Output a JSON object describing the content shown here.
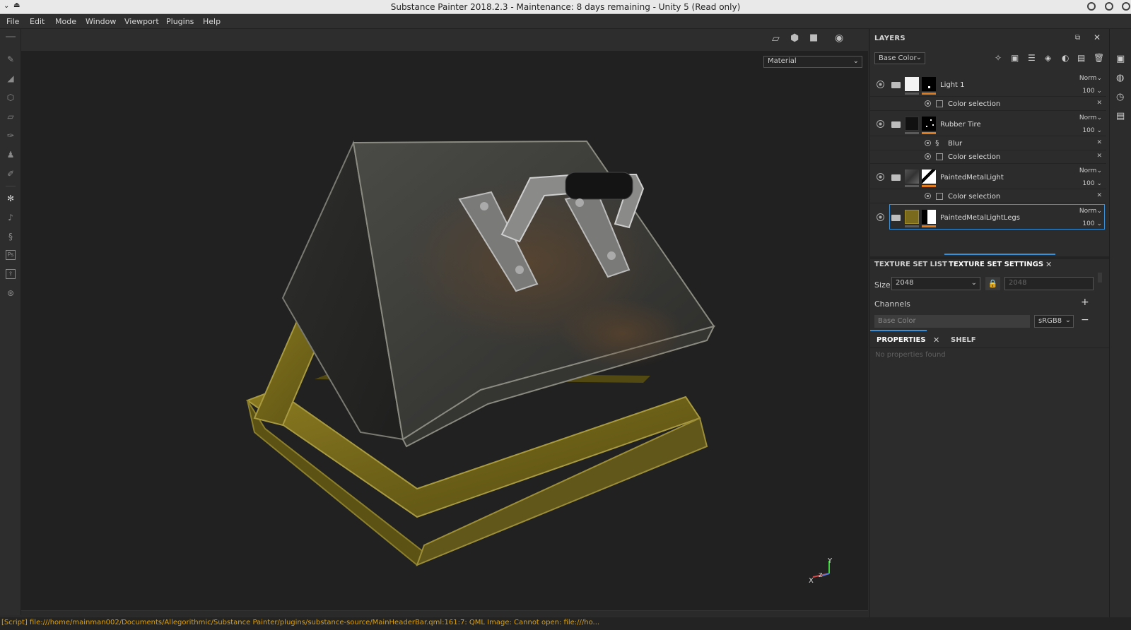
{
  "window": {
    "title": "Substance Painter 2018.2.3 - Maintenance: 8 days remaining - Unity 5 (Read only)"
  },
  "menu": [
    "File",
    "Edit",
    "Mode",
    "Window",
    "Viewport",
    "Plugins",
    "Help"
  ],
  "viewport": {
    "material_select": "Material",
    "axis": {
      "x": "X",
      "y": "Y",
      "z": "Z"
    }
  },
  "layers": {
    "header": "LAYERS",
    "channel_select": "Base Color",
    "items": [
      {
        "name": "Light 1",
        "blend": "Norm",
        "opacity": "100",
        "effects": [
          {
            "name": "Color selection",
            "icon": "checkbox-icon"
          }
        ]
      },
      {
        "name": "Rubber Tire",
        "blend": "Norm",
        "opacity": "100",
        "effects": [
          {
            "name": "Blur",
            "icon": "blur-icon"
          },
          {
            "name": "Color selection",
            "icon": "checkbox-icon"
          }
        ]
      },
      {
        "name": "PaintedMetalLight",
        "blend": "Norm",
        "opacity": "100",
        "effects": [
          {
            "name": "Color selection",
            "icon": "checkbox-icon"
          }
        ]
      },
      {
        "name": "PaintedMetalLightLegs",
        "blend": "Norm",
        "opacity": "100",
        "effects": []
      }
    ]
  },
  "texture_set": {
    "tab_list": "TEXTURE SET LIST",
    "tab_settings": "TEXTURE SET SETTINGS",
    "size_label": "Size",
    "size_value": "2048",
    "size_locked_value": "2048",
    "channels_label": "Channels",
    "channel_name": "Base Color",
    "channel_format": "sRGB8"
  },
  "properties": {
    "tab": "PROPERTIES",
    "shelf_tab": "SHELF",
    "empty_text": "No properties found"
  },
  "status": "[Script] file:///home/mainman002/Documents/Allegorithmic/Substance Painter/plugins/substance-source/MainHeaderBar.qml:161:7: QML Image: Cannot open: file:///ho..."
}
